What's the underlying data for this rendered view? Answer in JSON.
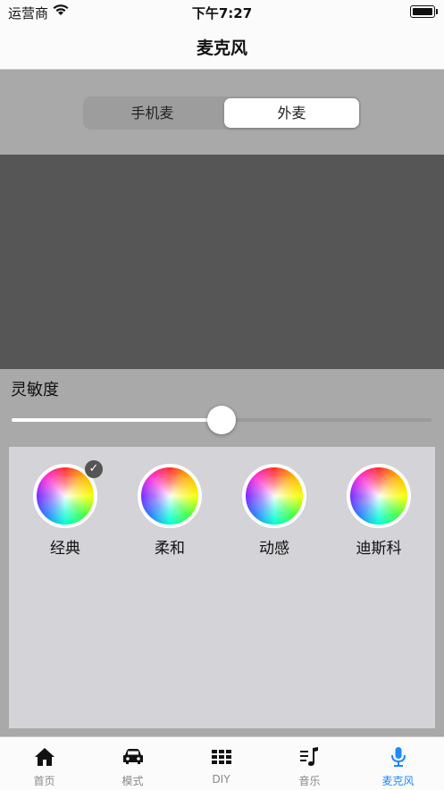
{
  "status_bar": {
    "carrier": "运营商",
    "time": "下午7:27"
  },
  "nav": {
    "title": "麦克风"
  },
  "segment": {
    "options": [
      "手机麦",
      "外麦"
    ],
    "selected": "外麦"
  },
  "sensitivity": {
    "label": "灵敏度",
    "value": 0.5
  },
  "modes": [
    {
      "label": "经典",
      "selected": true
    },
    {
      "label": "柔和",
      "selected": false
    },
    {
      "label": "动感",
      "selected": false
    },
    {
      "label": "迪斯科",
      "selected": false
    }
  ],
  "tabs": [
    {
      "label": "首页",
      "icon": "home-icon"
    },
    {
      "label": "模式",
      "icon": "car-icon"
    },
    {
      "label": "DIY",
      "icon": "grid-icon"
    },
    {
      "label": "音乐",
      "icon": "music-icon"
    },
    {
      "label": "麦克风",
      "icon": "microphone-icon",
      "active": true
    }
  ],
  "colors": {
    "accent": "#1e88ff",
    "panel": "#d3d3d8",
    "preview": "#565656",
    "background": "#a9a9a9"
  }
}
